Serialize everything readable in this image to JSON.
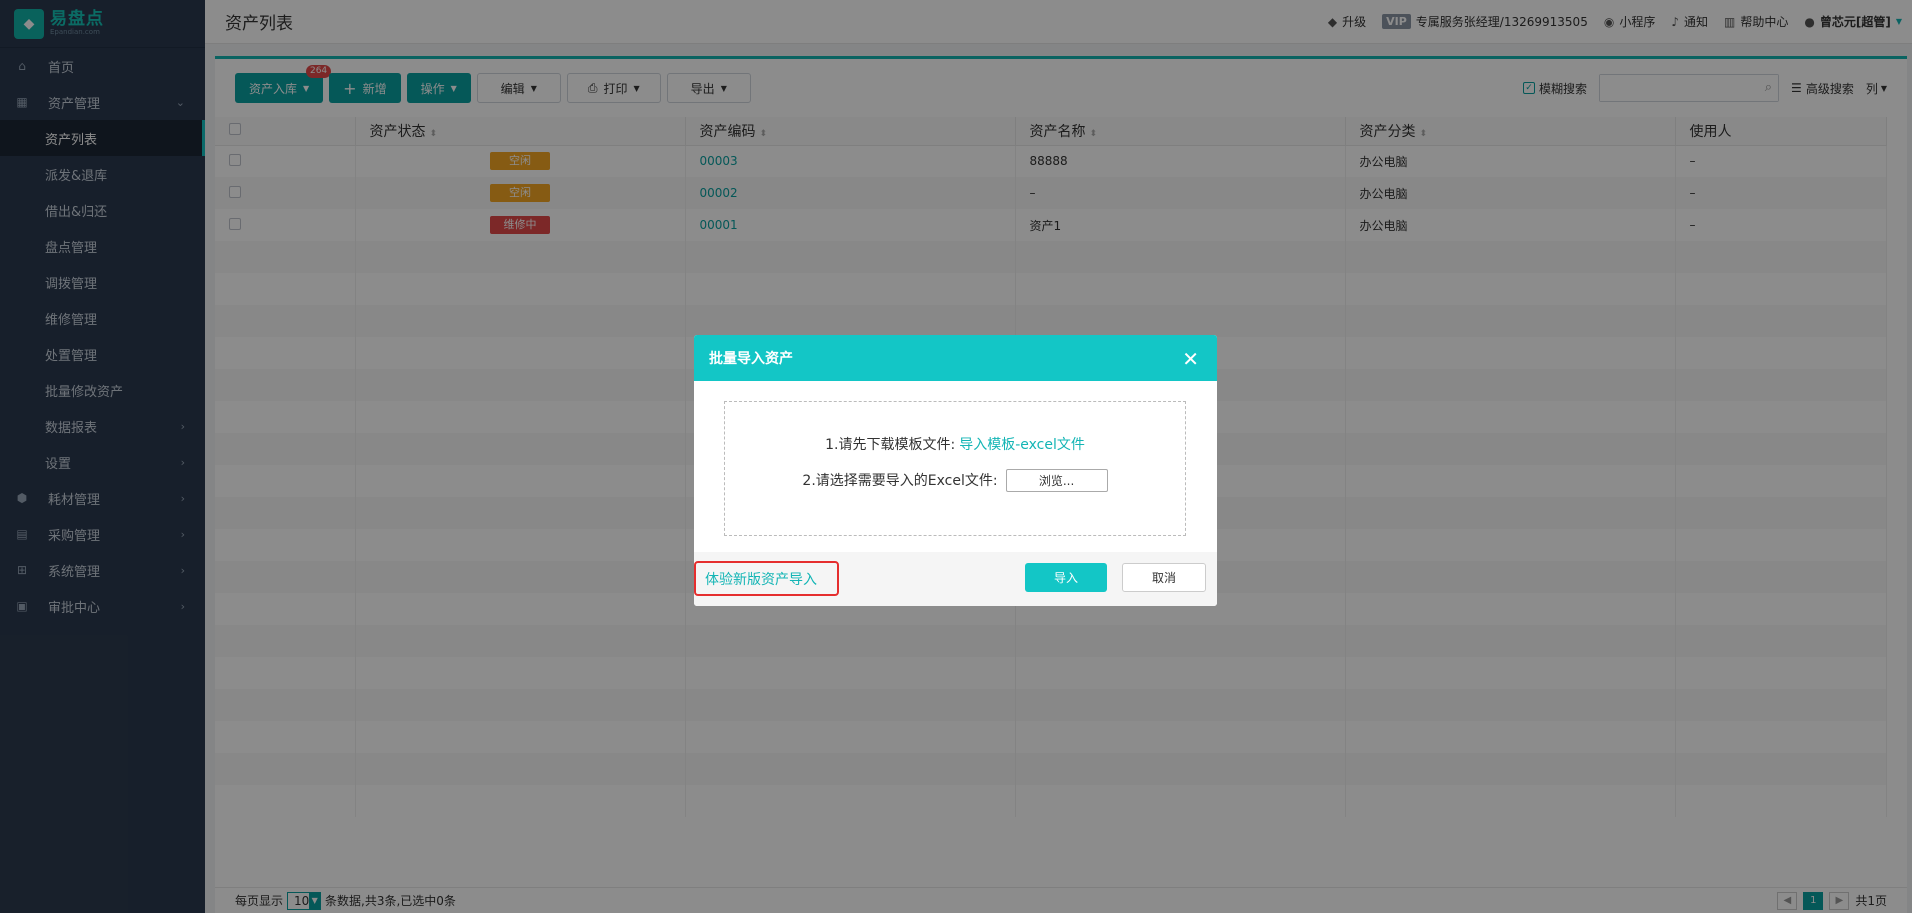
{
  "sidebar": {
    "logo_cn": "易盘点",
    "logo_en": "Epandian.com",
    "items": [
      {
        "label": "首页"
      },
      {
        "label": "资产管理"
      },
      {
        "label": "资产列表"
      },
      {
        "label": "派发&退库"
      },
      {
        "label": "借出&归还"
      },
      {
        "label": "盘点管理"
      },
      {
        "label": "调拨管理"
      },
      {
        "label": "维修管理"
      },
      {
        "label": "处置管理"
      },
      {
        "label": "批量修改资产"
      },
      {
        "label": "数据报表"
      },
      {
        "label": "设置"
      },
      {
        "label": "耗材管理"
      },
      {
        "label": "采购管理"
      },
      {
        "label": "系统管理"
      },
      {
        "label": "审批中心"
      }
    ]
  },
  "header": {
    "title": "资产列表",
    "upgrade": "升级",
    "vip": "VIP",
    "service": "专属服务张经理/13269913505",
    "miniapp": "小程序",
    "notify": "通知",
    "help": "帮助中心",
    "user": "曾芯元[超管]"
  },
  "toolbar": {
    "stock_in": "资产入库",
    "stock_in_badge": "264",
    "add": "新增",
    "operate": "操作",
    "edit": "编辑",
    "print": "打印",
    "export": "导出",
    "fuzzy": "模糊搜索",
    "search_placeholder": "",
    "advanced": "高级搜索",
    "columns": "列"
  },
  "table": {
    "headers": [
      "资产状态",
      "资产编码",
      "资产名称",
      "资产分类",
      "使用人"
    ],
    "rows": [
      {
        "status": "空闲",
        "status_color": "#f5a623",
        "code": "00003",
        "name": "88888",
        "category": "办公电脑",
        "user": "–"
      },
      {
        "status": "空闲",
        "status_color": "#f5a623",
        "code": "00002",
        "name": "–",
        "category": "办公电脑",
        "user": "–"
      },
      {
        "status": "维修中",
        "status_color": "#e24a4a",
        "code": "00001",
        "name": "资产1",
        "category": "办公电脑",
        "user": "–"
      }
    ]
  },
  "footer": {
    "per_page_label": "每页显示",
    "per_page": "10",
    "summary": "条数据,共3条,已选中0条",
    "page": "1",
    "total_pages": "共1页"
  },
  "modal": {
    "title": "批量导入资产",
    "step1_label": "1.请先下载模板文件:",
    "step1_link": "导入模板-excel文件",
    "step2_label": "2.请选择需要导入的Excel文件:",
    "browse": "浏览...",
    "new_import": "体验新版资产导入",
    "import": "导入",
    "cancel": "取消"
  },
  "colors": {
    "sidebar_bg": "#2b3a4f",
    "accent": "#13c6c6",
    "highlight_border": "#e52e2e"
  }
}
